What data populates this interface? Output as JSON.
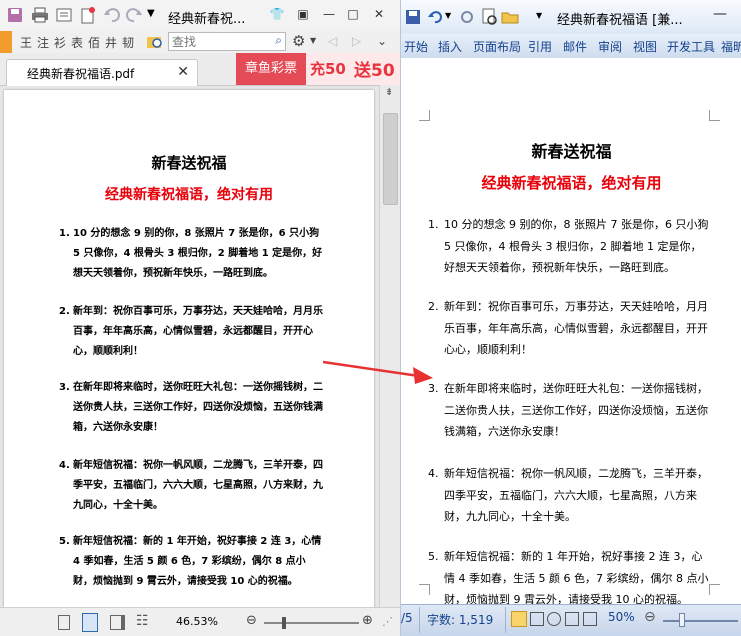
{
  "pdf_reader": {
    "title": "经典新春祝...",
    "toolbar_chars": [
      "王",
      "注",
      "衫",
      "表",
      "佰",
      "井",
      "韧"
    ],
    "search_placeholder": "查找",
    "tab_label": "经典新春祝福语.pdf",
    "ad": {
      "brand": "章鱼彩票",
      "offer1": "充50",
      "offer2": "送50"
    },
    "zoom": "46.53%"
  },
  "word": {
    "title": "经典新春祝福语 [兼...",
    "ribbon_tabs": [
      "开始",
      "插入",
      "页面布局",
      "引用",
      "邮件",
      "审阅",
      "视图",
      "开发工具",
      "福昕"
    ],
    "status": {
      "page_fragment": "/5",
      "word_count": "字数: 1,519",
      "zoom": "50%"
    }
  },
  "document": {
    "title": "新春送祝福",
    "subtitle": "经典新春祝福语，绝对有用",
    "items": [
      {
        "num": "1.",
        "text": "10 分的想念 9 别的你，8 张照片 7 张是你，6 只小狗 5 只像你，4 根骨头 3 根归你，2 脚着地 1 定是你，好想天天领着你，预祝新年快乐，一路旺到底。"
      },
      {
        "num": "2.",
        "text": "新年到：祝你百事可乐，万事芬达，天天娃哈哈，月月乐百事，年年高乐高，心情似雪碧，永远都醒目，开开心心，顺顺利利！"
      },
      {
        "num": "3.",
        "text": "在新年即将来临时，送你旺旺大礼包：一送你摇钱树，二送你贵人扶，三送你工作好，四送你没烦恼，五送你钱满箱，六送你永安康！"
      },
      {
        "num": "4.",
        "text": "新年短信祝福：祝你一帆风顺，二龙腾飞，三羊开泰，四季平安，五福临门，六六大顺，七星高照，八方来财，九九同心，十全十美。"
      },
      {
        "num": "5.",
        "text": "新年短信祝福：新的 1 年开始，祝好事接 2 连 3，心情 4 季如春，生活 5 颜 6 色，7 彩缤纷，偶尔 8 点小财，烦恼抛到 9 霄云外，请接受我 10 心的祝福。"
      }
    ]
  },
  "colors": {
    "subtitle": "#e8000b",
    "arrow": "#e83232",
    "word_ribbon_text": "#15428b",
    "ad_red": "#e54b57"
  }
}
